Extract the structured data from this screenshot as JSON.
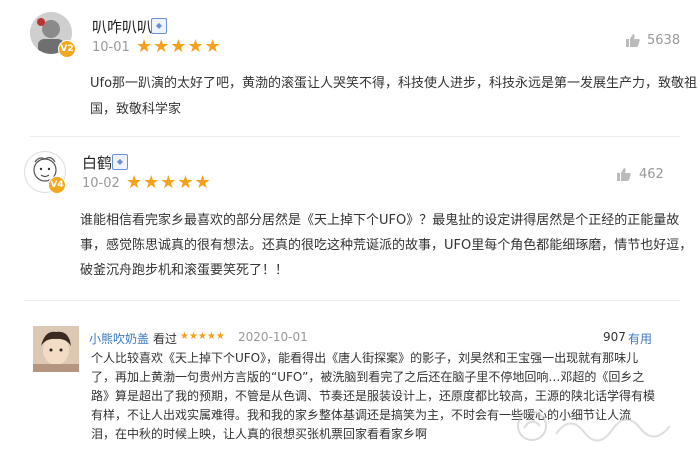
{
  "reviews": [
    {
      "username": "叭咋叭叭",
      "vip_icon": "vip-badge-icon",
      "level": "V2",
      "date": "10-01",
      "stars": "★★★★★",
      "likes": "5638",
      "text_lines": [
        "Ufo那一趴演的太好了吧，黄渤的滚蛋让人哭笑不得，科技使人进步，科技永远是第一发展生产力，致敬祖",
        "国，致敬科学家"
      ]
    },
    {
      "username": "白鹤",
      "vip_icon": "vip-badge-icon",
      "level": "V4",
      "date": "10-02",
      "stars": "★★★★★",
      "likes": "462",
      "text_lines": [
        "谁能相信看完家乡最喜欢的部分居然是《天上掉下个UFO》？最鬼扯的设定讲得居然是个正经的正能量故",
        "事，感觉陈思诚真的很有想法。还真的很吃这种荒诞派的故事，UFO里每个角色都能细琢磨，情节也好逗，",
        "破釜沉舟跑步机和滚蛋要笑死了！！"
      ]
    }
  ],
  "review3": {
    "username": "小熊吹奶盖",
    "tag": "看过",
    "stars": "★★★★★",
    "date": "2020-10-01",
    "useful_count": "907",
    "useful_label": "有用",
    "text_lines": [
      "个人比较喜欢《天上掉下个UFO》，能看得出《唐人街探案》的影子，刘昊然和王宝强一出现就有那味儿",
      "了，再加上黄渤一句贵州方言版的“UFO”，被洗脑到看完了之后还在脑子里不停地回响…邓超的《回乡之",
      "路》算是超出了我的预期，不管是从色调、节奏还是服装设计上，还原度都比较高，王源的陕北话学得有模",
      "有样，不让人出戏实属难得。我和我的家乡整体基调还是搞笑为主，不时会有一些暖心的小细节让人流",
      "泪，在中秋的时候上映，让人真的很想买张机票回家看看家乡啊"
    ]
  },
  "colors": {
    "star": "#f7a01a",
    "link": "#3a79c8",
    "badge": "#f0a81e"
  }
}
